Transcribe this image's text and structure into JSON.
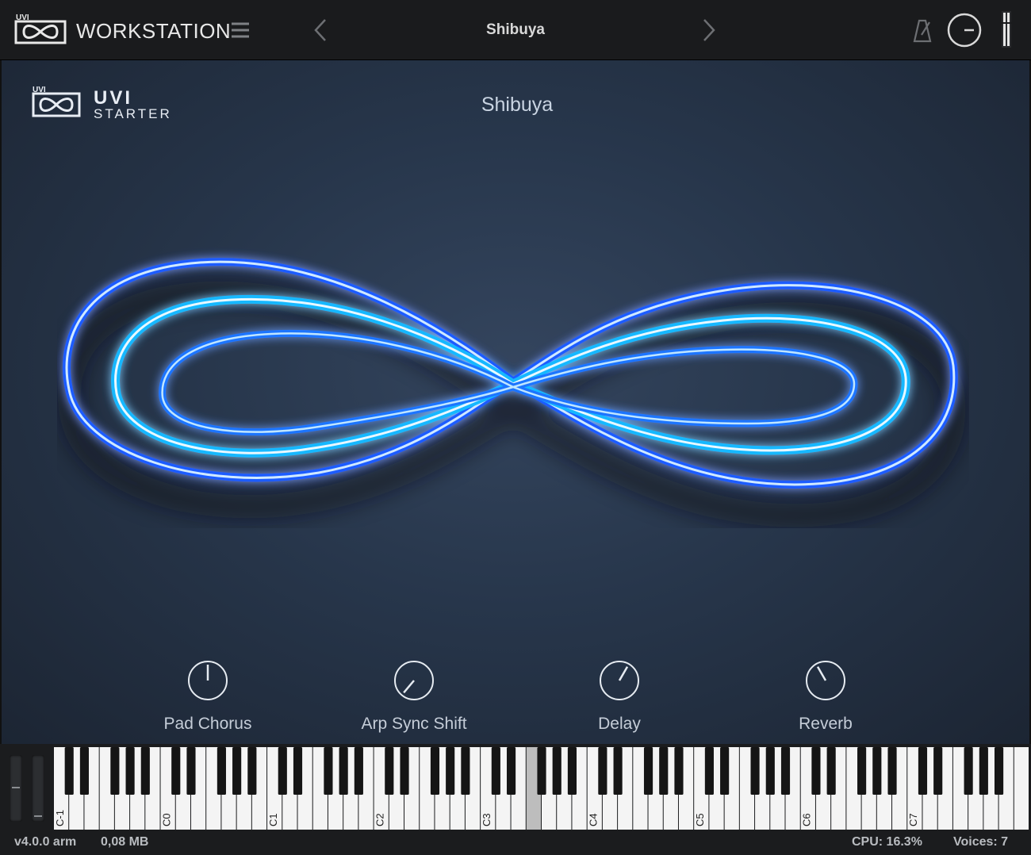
{
  "topbar": {
    "logo_text": "UVI",
    "app_title": "WORKSTATION",
    "preset_name": "Shibuya",
    "menu_icon": "hamburger-menu-icon",
    "prev_icon": "chevron-left-icon",
    "next_icon": "chevron-right-icon",
    "metronome_icon": "metronome-icon",
    "master_volume_icon": "volume-knob-icon"
  },
  "panel": {
    "brand_logo_text": "UVI",
    "brand_name": "UVI",
    "brand_sub": "STARTER",
    "preset_title": "Shibuya",
    "artwork": "infinity-symbol"
  },
  "knobs": [
    {
      "label": "Pad Chorus",
      "angle": 0
    },
    {
      "label": "Arp Sync Shift",
      "angle": -140
    },
    {
      "label": "Delay",
      "angle": 30
    },
    {
      "label": "Reverb",
      "angle": -30
    }
  ],
  "keyboard": {
    "octave_labels": [
      "C-1",
      "C0",
      "C1",
      "C2",
      "C3",
      "C4",
      "C5",
      "C6",
      "C7"
    ],
    "colors": {
      "white_key": "#f4f4f4",
      "black_key": "#151515",
      "pressed_key": "#bdbdbd"
    }
  },
  "status": {
    "version": "v4.0.0 arm",
    "memory": "0,08 MB",
    "cpu": "CPU: 16.3%",
    "voices": "Voices: 7"
  },
  "colors": {
    "accent_glow": "#33c9ff",
    "panel_bg": "#2a3a50",
    "topbar_bg": "#1a1b1d"
  }
}
